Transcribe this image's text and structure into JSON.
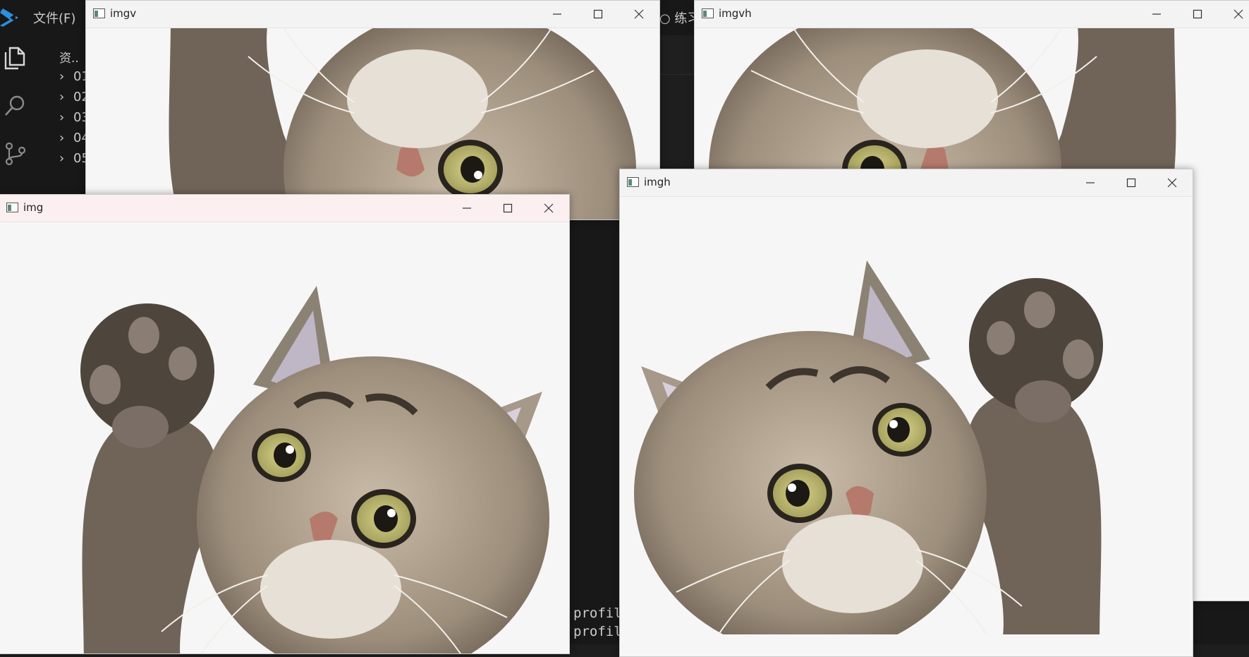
{
  "vscode": {
    "menu_file": "文件(F)",
    "search_fragment": "○ 练习",
    "explorer_title": "资..",
    "tree": [
      "01",
      "02",
      "03",
      "04",
      "05"
    ],
    "terminal_lines": [
      "profil",
      "profil"
    ]
  },
  "windows": [
    {
      "key": "imgv",
      "title": "imgv",
      "flip": "vertical"
    },
    {
      "key": "imgvh",
      "title": "imgvh",
      "flip": "both"
    },
    {
      "key": "imgh",
      "title": "imgh",
      "flip": "horizontal"
    },
    {
      "key": "img",
      "title": "img",
      "flip": "none",
      "active": true
    }
  ],
  "icons": {
    "app": "vscode-logo-icon",
    "activity": [
      "files-icon",
      "search-icon",
      "source-control-icon"
    ],
    "window_buttons": [
      "minimize-icon",
      "maximize-icon",
      "close-icon"
    ]
  },
  "colors": {
    "vscode_bg": "#1e1e1e",
    "vscode_blue": "#2c8fe0",
    "window_title_active": "#fbf0ef",
    "window_title_inactive": "#f3f3f3",
    "image_bg": "#f6f6f6",
    "fur": "#9d8e7c",
    "eye": "#a8a45f"
  }
}
